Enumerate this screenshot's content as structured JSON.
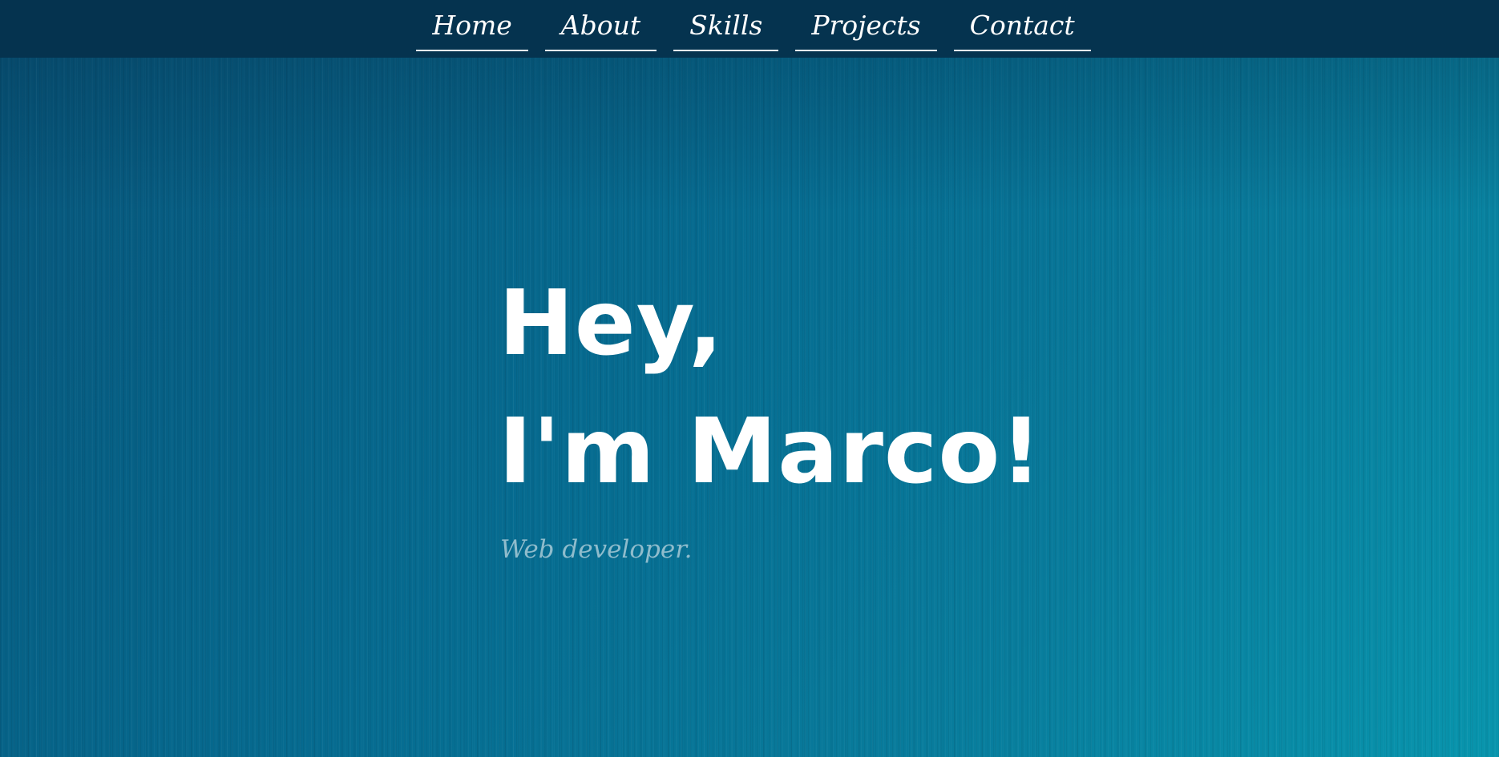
{
  "nav": {
    "items": [
      {
        "label": "Home"
      },
      {
        "label": "About"
      },
      {
        "label": "Skills"
      },
      {
        "label": "Projects"
      },
      {
        "label": "Contact"
      }
    ]
  },
  "hero": {
    "greeting": "Hey,",
    "name_line": "I'm Marco!",
    "subtitle": "Web developer."
  },
  "colors": {
    "navbar_bg": "#05334f",
    "hero_gradient_start": "#07557a",
    "hero_gradient_end": "#0895ad",
    "heading_text": "#ffffff",
    "subtitle_text": "#8fbccc"
  }
}
